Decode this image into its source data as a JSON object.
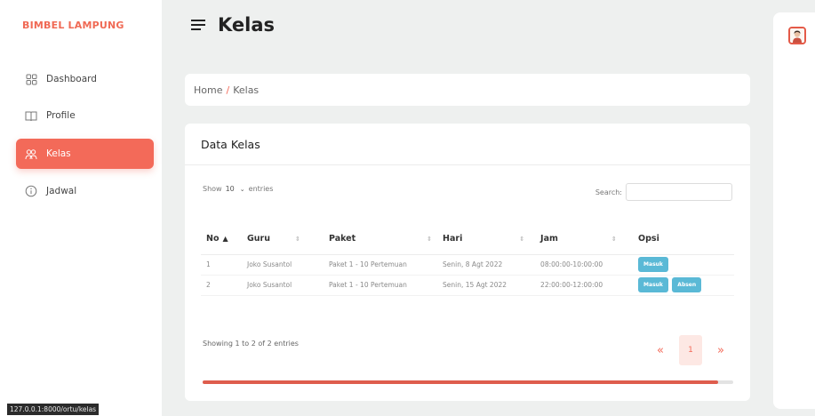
{
  "sidebar": {
    "brand": "BIMBEL LAMPUNG",
    "items": [
      {
        "label": "Dashboard",
        "icon": "grid-icon"
      },
      {
        "label": "Profile",
        "icon": "book-icon"
      },
      {
        "label": "Kelas",
        "icon": "users-icon",
        "active": true
      },
      {
        "label": "Jadwal",
        "icon": "info-circle-icon"
      }
    ]
  },
  "status_url": "127.0.0.1:8000/ortu/kelas",
  "header": {
    "title": "Kelas"
  },
  "breadcrumb": {
    "home": "Home",
    "separator": "/",
    "current": "Kelas"
  },
  "card": {
    "title": "Data Kelas",
    "show_label": "Show",
    "entries_value": "10",
    "entries_label": "entries",
    "search_label": "Search:",
    "search_value": ""
  },
  "table": {
    "columns": [
      "No",
      "Guru",
      "Paket",
      "Hari",
      "Jam",
      "Opsi"
    ],
    "rows": [
      {
        "no": "1",
        "guru": "Joko Susantol",
        "paket": "Paket 1 - 10 Pertemuan",
        "hari": "Senin, 8 Agt 2022",
        "jam": "08:00:00-10:00:00",
        "masuk": "Masuk",
        "absen": null
      },
      {
        "no": "2",
        "guru": "Joko Susantol",
        "paket": "Paket 1 - 10 Pertemuan",
        "hari": "Senin, 15 Agt 2022",
        "jam": "22:00:00-12:00:00",
        "masuk": "Masuk",
        "absen": "Absen"
      }
    ]
  },
  "footer": {
    "info": "Showing 1 to 2 of 2 entries",
    "prev": "«",
    "page": "1",
    "next": "»"
  },
  "colors": {
    "accent": "#f36a59",
    "button": "#5ab9d6"
  }
}
